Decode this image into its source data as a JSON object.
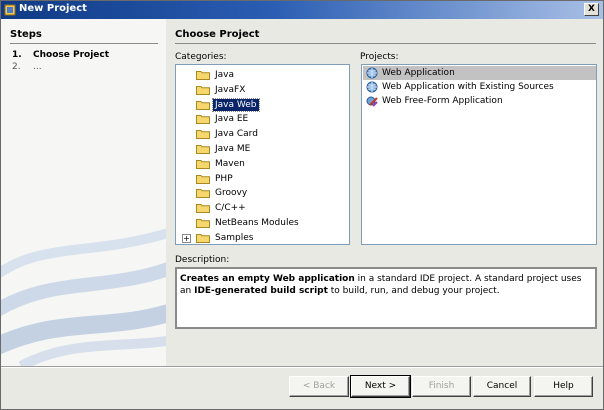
{
  "window": {
    "title": "New Project",
    "close_label": "X"
  },
  "steps": {
    "heading": "Steps",
    "items": [
      {
        "num": "1.",
        "label": "Choose Project"
      },
      {
        "num": "2.",
        "label": "..."
      }
    ]
  },
  "main": {
    "heading": "Choose Project",
    "categories_label": "Categories:",
    "projects_label": "Projects:",
    "description_label": "Description:"
  },
  "categories": [
    {
      "label": "Java",
      "selected": false,
      "expandable": false
    },
    {
      "label": "JavaFX",
      "selected": false,
      "expandable": false
    },
    {
      "label": "Java Web",
      "selected": true,
      "expandable": false
    },
    {
      "label": "Java EE",
      "selected": false,
      "expandable": false
    },
    {
      "label": "Java Card",
      "selected": false,
      "expandable": false
    },
    {
      "label": "Java ME",
      "selected": false,
      "expandable": false
    },
    {
      "label": "Maven",
      "selected": false,
      "expandable": false
    },
    {
      "label": "PHP",
      "selected": false,
      "expandable": false
    },
    {
      "label": "Groovy",
      "selected": false,
      "expandable": false
    },
    {
      "label": "C/C++",
      "selected": false,
      "expandable": false
    },
    {
      "label": "NetBeans Modules",
      "selected": false,
      "expandable": false
    },
    {
      "label": "Samples",
      "selected": false,
      "expandable": true,
      "expander": "+"
    }
  ],
  "projects": [
    {
      "label": "Web Application",
      "icon": "globe-icon",
      "selected": true
    },
    {
      "label": "Web Application with Existing Sources",
      "icon": "globe-icon",
      "selected": false
    },
    {
      "label": "Web Free-Form Application",
      "icon": "freeform-web-icon",
      "selected": false
    }
  ],
  "description": {
    "part1_bold": "Creates an empty Web application",
    "part2": " in a standard IDE project. A standard project uses an ",
    "part3_bold": "IDE-generated build script",
    "part4": " to build, run, and debug your project."
  },
  "buttons": {
    "back": "< Back",
    "next": "Next >",
    "finish": "Finish",
    "cancel": "Cancel",
    "help": "Help"
  },
  "colors": {
    "title_bar_start": "#103a85",
    "selection": "#0a246a",
    "folder": "#f5d76e"
  }
}
